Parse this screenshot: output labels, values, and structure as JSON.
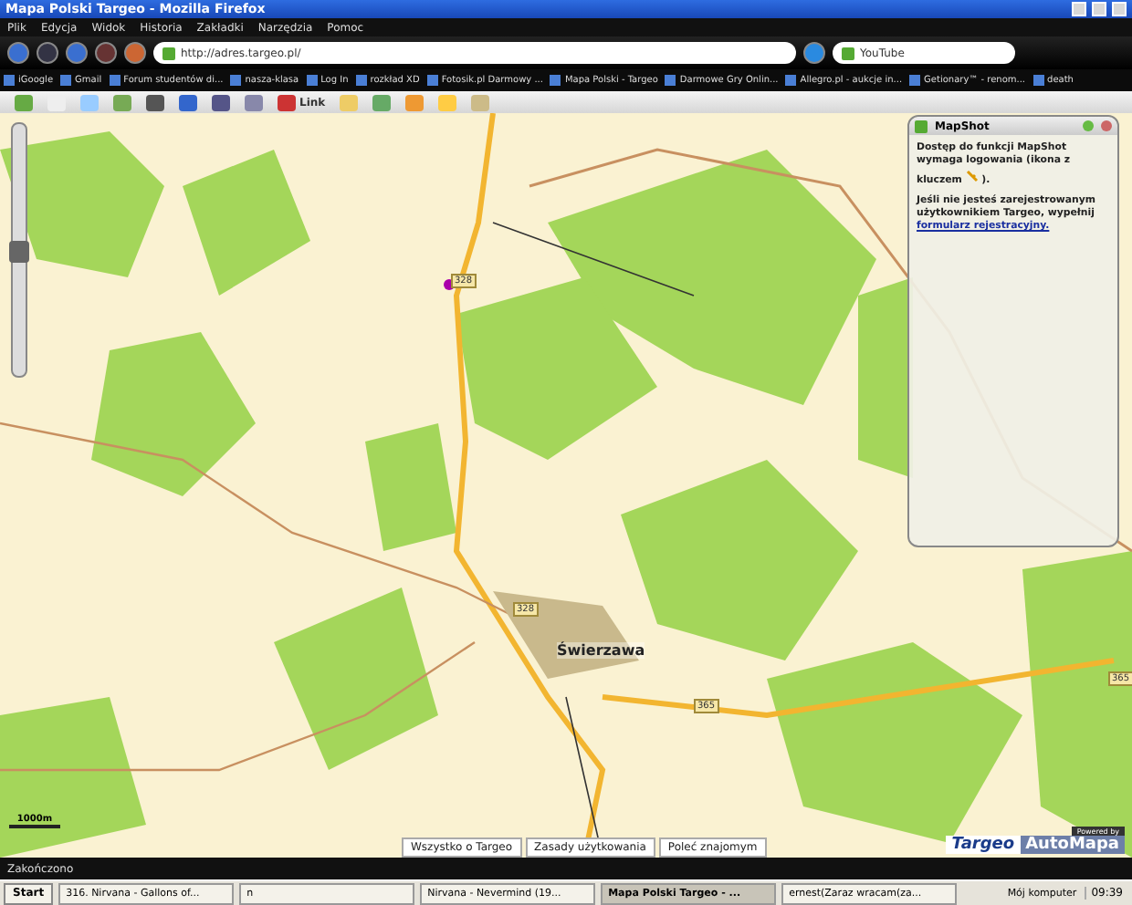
{
  "window": {
    "title": "Mapa Polski Targeo - Mozilla Firefox"
  },
  "menu": [
    "Plik",
    "Edycja",
    "Widok",
    "Historia",
    "Zakładki",
    "Narzędzia",
    "Pomoc"
  ],
  "address_bar": {
    "value": "http://adres.targeo.pl/"
  },
  "search_field": {
    "value": "YouTube"
  },
  "bookmarks": [
    "iGoogle",
    "Gmail",
    "Forum studentów di...",
    "nasza-klasa",
    "Log In",
    "rozkład XD",
    "Fotosik.pl Darmowy ...",
    "Mapa Polski - Targeo",
    "Darmowe Gry Onlin...",
    "Allegro.pl - aukcje in...",
    "Getionary™ - renom...",
    "death"
  ],
  "map_toolbar": {
    "link_label": "Link"
  },
  "map": {
    "zoom_slider": {
      "level": 0.5
    },
    "town": "Świerzawa",
    "road_numbers": [
      "328",
      "328",
      "365",
      "365"
    ],
    "scale": "1000m",
    "footer_links": [
      "Wszystko o Targeo",
      "Zasady użytkowania",
      "Poleć znajomym"
    ],
    "branding": {
      "powered_by": "Powered by",
      "targeo": "Targeo",
      "automapa": "AutoMapa"
    }
  },
  "mapshot_panel": {
    "title": "MapShot",
    "text1": "Dostęp do funkcji MapShot wymaga logowania (ikona z kluczem",
    "text1_end": ").",
    "text2": "Jeśli nie jesteś zarejestrowanym użytkownikiem Targeo, wypełnij",
    "link": "formularz rejestracyjny."
  },
  "status_bar": {
    "text": "Zakończono"
  },
  "taskbar": {
    "start": "Start",
    "tasks": [
      {
        "label": "316. Nirvana - Gallons of...",
        "selected": false
      },
      {
        "label": "n",
        "selected": false
      },
      {
        "label": "Nirvana - Nevermind (19...",
        "selected": false
      },
      {
        "label": "Mapa Polski Targeo - ...",
        "selected": true
      },
      {
        "label": "ernest(Zaraz wracam(za...",
        "selected": false
      }
    ],
    "tray_label": "Mój komputer",
    "clock": "09:39"
  }
}
